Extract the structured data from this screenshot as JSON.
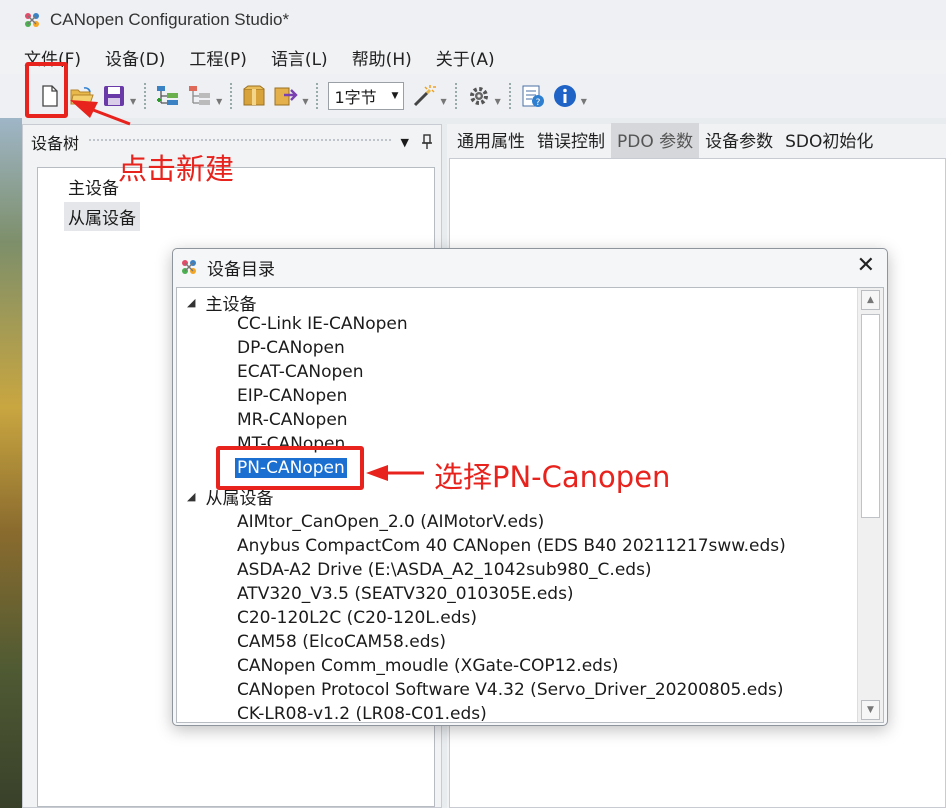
{
  "window": {
    "title": "CANopen Configuration Studio*"
  },
  "menu": [
    "文件(F)",
    "设备(D)",
    "工程(P)",
    "语言(L)",
    "帮助(H)",
    "关于(A)"
  ],
  "toolbar": {
    "byte_select_value": "1字节"
  },
  "left_panel": {
    "title": "设备树",
    "tree": [
      "主设备",
      "从属设备"
    ]
  },
  "tabs": [
    "通用属性",
    "错误控制",
    "PDO 参数",
    "设备参数",
    "SDO初始化"
  ],
  "dialog": {
    "title": "设备目录",
    "master_label": "主设备",
    "master_items": [
      "CC-Link IE-CANopen",
      "DP-CANopen",
      "ECAT-CANopen",
      "EIP-CANopen",
      "MR-CANopen",
      "MT-CANopen",
      "PN-CANopen"
    ],
    "slave_label": "从属设备",
    "slave_items": [
      "AIMtor_CanOpen_2.0 (AIMotorV.eds)",
      "Anybus CompactCom 40 CANopen (EDS B40 20211217sww.eds)",
      "ASDA-A2 Drive (E:\\ASDA_A2_1042sub980_C.eds)",
      "ATV320_V3.5 (SEATV320_010305E.eds)",
      "C20-120L2C (C20-120L.eds)",
      "CAM58 (ElcoCAM58.eds)",
      "CANopen Comm_moudle (XGate-COP12.eds)",
      "CANopen Protocol Software V4.32 (Servo_Driver_20200805.eds)",
      "CK-LR08-v1.2 (LR08-C01.eds)"
    ]
  },
  "annotations": {
    "click_new": "点击新建",
    "select_pn": "选择PN-Canopen"
  },
  "colors": {
    "annotation": "#e8221c",
    "selection": "#1a6fd1"
  }
}
